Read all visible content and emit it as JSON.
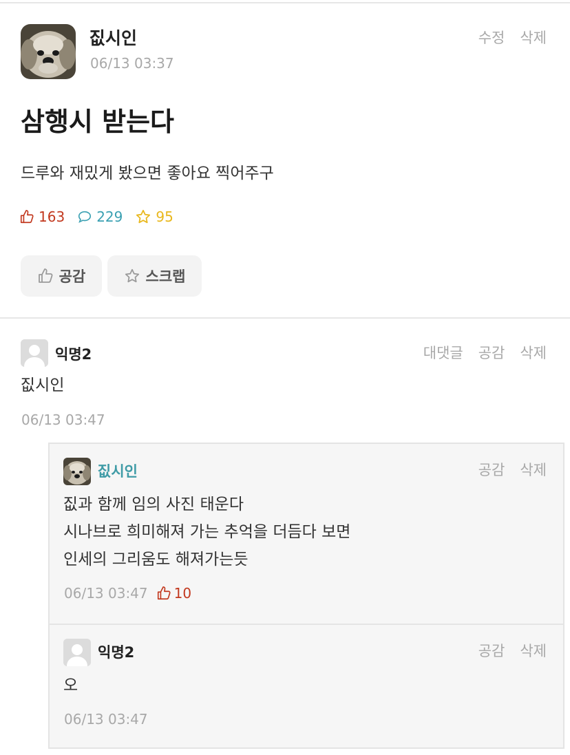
{
  "post": {
    "author": "짒시인",
    "time": "06/13 03:37",
    "actions": {
      "edit": "수정",
      "delete": "삭제"
    },
    "title": "삼행시 받는다",
    "body": "드루와 재밌게 봤으면 좋아요 찍어주구",
    "stats": {
      "likes": "163",
      "comments": "229",
      "scraps": "95"
    },
    "buttons": {
      "like": "공감",
      "scrap": "스크랩"
    }
  },
  "comments": [
    {
      "author": "익명2",
      "text": "짒시인",
      "time": "06/13 03:47",
      "actions": {
        "reply": "대댓글",
        "like": "공감",
        "delete": "삭제"
      }
    }
  ],
  "replies": [
    {
      "author": "짒시인",
      "lines": [
        "짒과 함께 임의 사진 태운다",
        "시나브로 희미해져 가는 추억을 더듬다 보면",
        "인세의 그리움도 해져가는듯"
      ],
      "time": "06/13 03:47",
      "likes": "10",
      "actions": {
        "like": "공감",
        "delete": "삭제"
      }
    },
    {
      "author": "익명2",
      "text": "오",
      "time": "06/13 03:47",
      "actions": {
        "like": "공감",
        "delete": "삭제"
      }
    }
  ],
  "colors": {
    "like": "#c2381e",
    "comment": "#3aa0b2",
    "scrap": "#e9b81e",
    "op_name": "#3f9ba6"
  },
  "icons": [
    "thumbs-up-icon",
    "speech-bubble-icon",
    "star-icon",
    "anonymous-avatar-icon",
    "dog-avatar"
  ]
}
